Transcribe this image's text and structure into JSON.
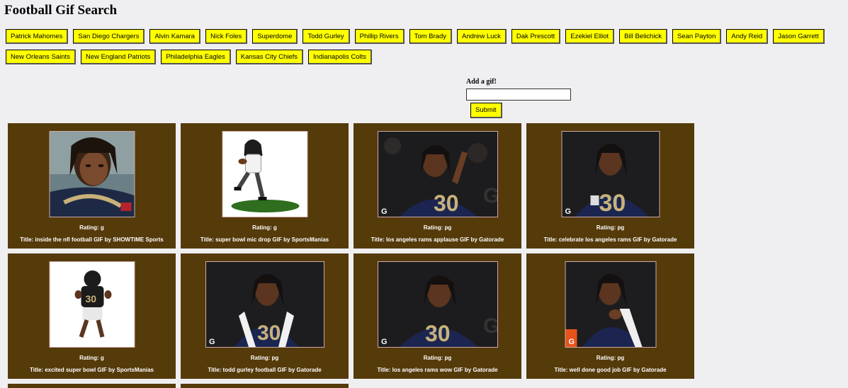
{
  "page": {
    "title": "Football Gif Search"
  },
  "topics": [
    "Patrick Mahomes",
    "San Diego Chargers",
    "Alvin Kamara",
    "Nick Foles",
    "Superdome",
    "Todd Gurley",
    "Phillip Rivers",
    "Tom Brady",
    "Andrew Luck",
    "Dak Prescott",
    "Ezekiel Elliot",
    "Bill Belichick",
    "Sean Payton",
    "Andy Reid",
    "Jason Garrett",
    "New Orleans Saints",
    "New England Patriots",
    "Philadelphia Eagles",
    "Kansas City Chiefs",
    "Indianapolis Colts"
  ],
  "add_form": {
    "label": "Add a gif!",
    "input_value": "",
    "submit_label": "Submit"
  },
  "gifs": [
    {
      "rating": "Rating: g",
      "title": "Title: inside the nfl football GIF by SHOWTIME Sports"
    },
    {
      "rating": "Rating: g",
      "title": "Title: super bowl mic drop GIF by SportsManias"
    },
    {
      "rating": "Rating: pg",
      "title": "Title: los angeles rams applause GIF by Gatorade"
    },
    {
      "rating": "Rating: pg",
      "title": "Title: celebrate los angeles rams GIF by Gatorade"
    },
    {
      "rating": "Rating: g",
      "title": "Title: excited super bowl GIF by SportsManias"
    },
    {
      "rating": "Rating: pg",
      "title": "Title: todd gurley football GIF by Gatorade"
    },
    {
      "rating": "Rating: pg",
      "title": "Title: los angeles rams wow GIF by Gatorade"
    },
    {
      "rating": "Rating: pg",
      "title": "Title: well done good job GIF by Gatorade"
    }
  ],
  "colors": {
    "button_bg": "#ffff00",
    "card_bg": "#553a0a",
    "page_bg": "#efeff2"
  }
}
